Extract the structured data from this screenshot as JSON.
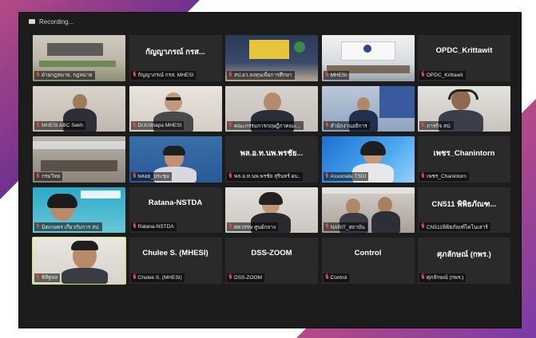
{
  "toolbar": {
    "recording_label": "Recording..."
  },
  "colors": {
    "mic_muted": "#e04646",
    "active_speaker": "#d6e45a",
    "tile_bg": "#2a2a2a"
  },
  "tiles": [
    {
      "display_name": "",
      "label": "ฝ่ายกฎหมาย, กฎหมาย"
    },
    {
      "display_name": "กัญญาภรณ์ กรส...",
      "label": "กัญญาภรณ์ กรส. MHESI"
    },
    {
      "display_name": "",
      "label": "สป.อว.ลงทุนเพื่อการศึกษา"
    },
    {
      "display_name": "",
      "label": "MHESI"
    },
    {
      "display_name": "OPDC_Krittawit",
      "label": "OPDC_Krittawit"
    },
    {
      "display_name": "",
      "label": "MHESI ABC Sekh"
    },
    {
      "display_name": "",
      "label": "Dr.Kritnapa MHESI"
    },
    {
      "display_name": "",
      "label": "คณะกรรมการกฤษฎีกาคณะ..."
    },
    {
      "display_name": "",
      "label": "สำนักงานอธิการ"
    },
    {
      "display_name": "",
      "label": "ภารกิจ สป."
    },
    {
      "display_name": "",
      "label": "กรมวิทย"
    },
    {
      "display_name": "",
      "label": "พลอย_ประชุม"
    },
    {
      "display_name": "พล.อ.ท.นพ.พรชัย...",
      "label": "พล.อ.ท.นพ.พรชัย สุรินทร์ ผบ.."
    },
    {
      "display_name": "",
      "label": "Associate TSDI"
    },
    {
      "display_name": "เพชร_Chanintorn",
      "label": "เพชร_Chanintorn"
    },
    {
      "display_name": "",
      "label": "นิตเกษตร เกี่ยวกับการ สป."
    },
    {
      "display_name": "Ratana-NSTDA",
      "label": "Ratana-NSTDA"
    },
    {
      "display_name": "",
      "label": "ศตวรรษ ศูนย์กลาง"
    },
    {
      "display_name": "",
      "label": "NARIT_สถาบัน"
    },
    {
      "display_name": "CN511 พิพิธภัณฑ...",
      "label": "CN511พิพิธภัณฑ์ไดโนเสาร์"
    },
    {
      "display_name": "",
      "label": "พิสิฐพล"
    },
    {
      "display_name": "Chulee S. (MHESI)",
      "label": "Chulee S. (MHESI)"
    },
    {
      "display_name": "DSS-ZOOM",
      "label": "DSS-ZOOM"
    },
    {
      "display_name": "Control",
      "label": "Control"
    },
    {
      "display_name": "ศุภลักษณ์ (กพร.)",
      "label": "ศุภลักษณ์ (กพร.)"
    }
  ]
}
